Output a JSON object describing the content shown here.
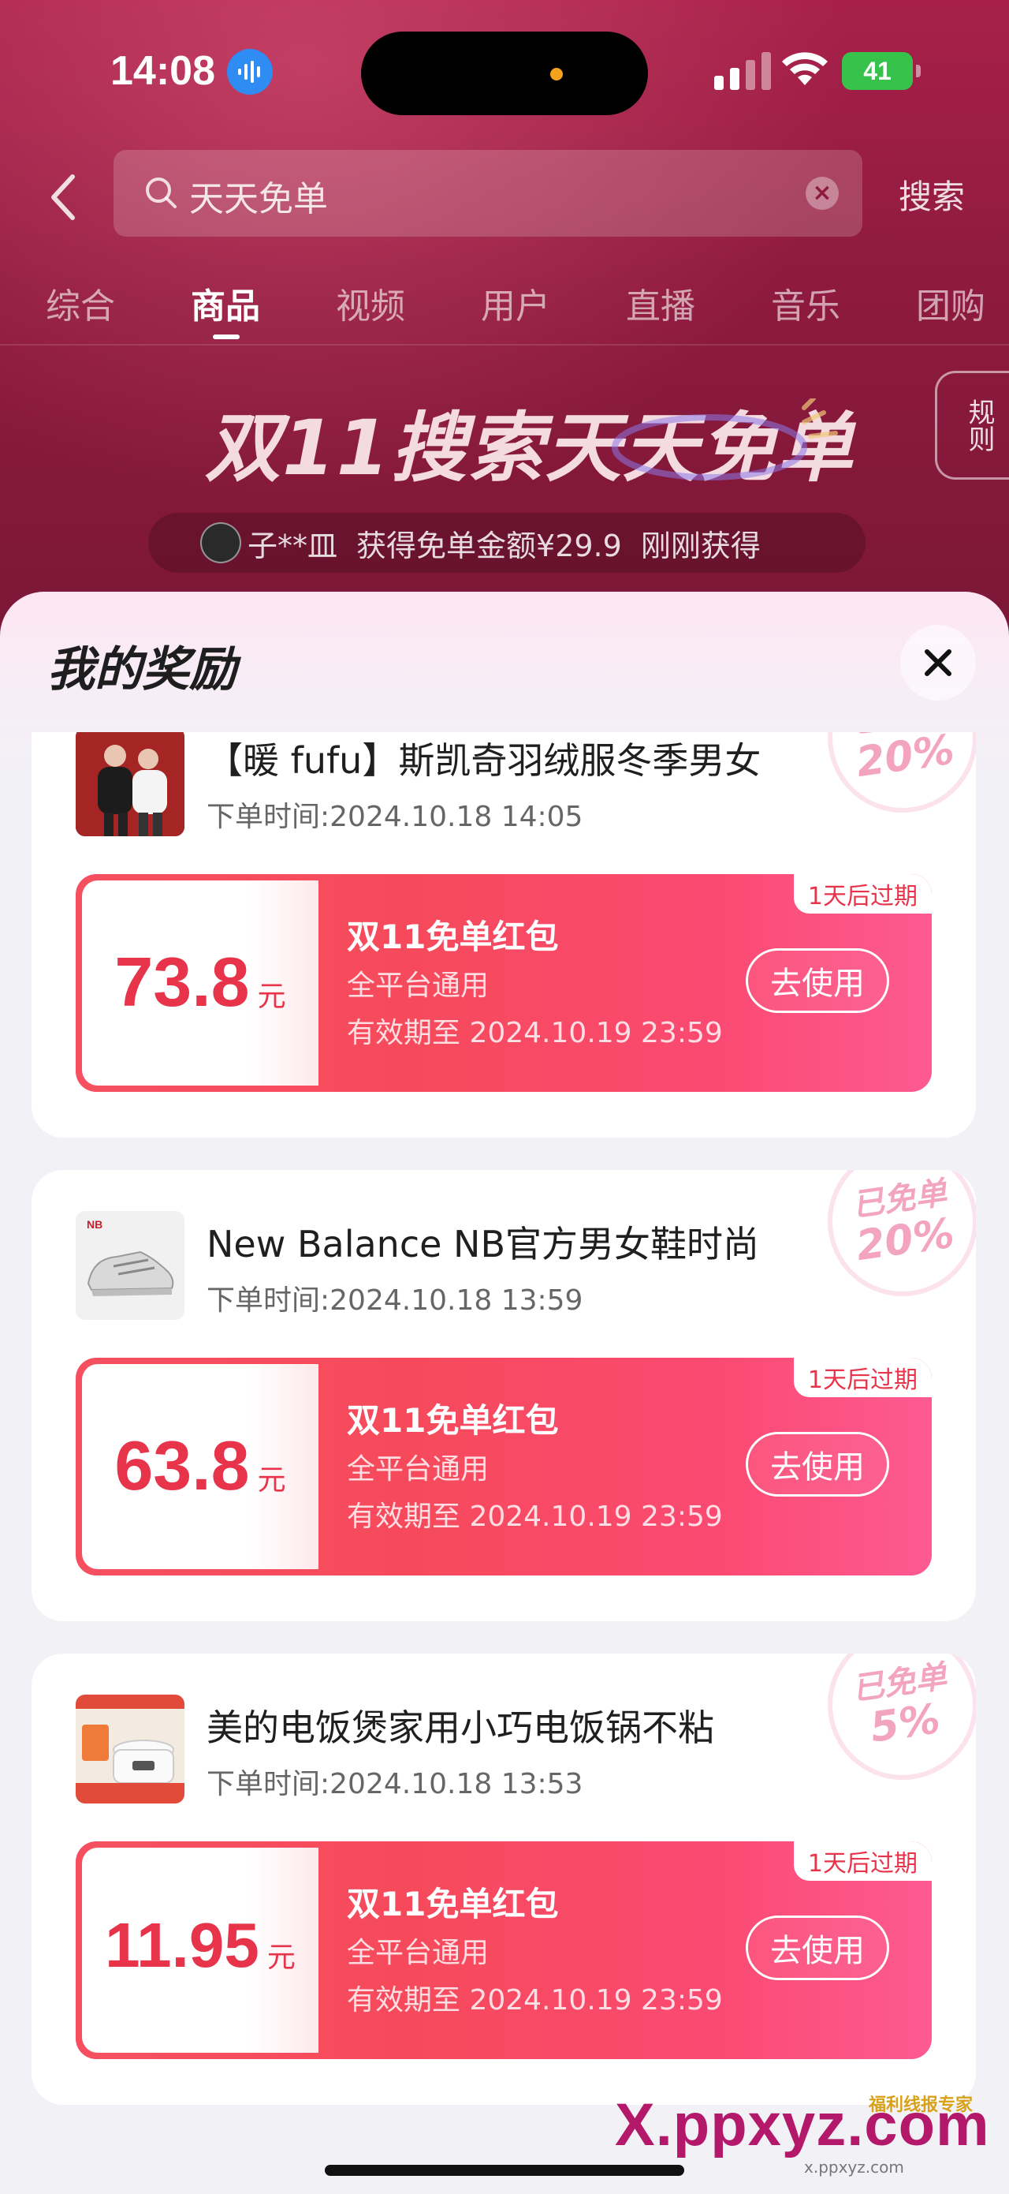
{
  "status_bar": {
    "time": "14:08",
    "battery": "41"
  },
  "search": {
    "query": "天天免单",
    "submit_label": "搜索"
  },
  "tabs": [
    {
      "label": "综合"
    },
    {
      "label": "商品"
    },
    {
      "label": "视频"
    },
    {
      "label": "用户"
    },
    {
      "label": "直播"
    },
    {
      "label": "音乐"
    },
    {
      "label": "团购"
    }
  ],
  "active_tab": "商品",
  "promo": {
    "banner": "双11搜索天天免单",
    "rules_label": "规则",
    "ticker_user": "子**皿",
    "ticker_text": "获得免单金额¥29.9",
    "ticker_time": "刚刚获得"
  },
  "sheet": {
    "title": "我的奖励"
  },
  "rewards": [
    {
      "title": "【暖 fufu】斯凯奇羽绒服冬季男女",
      "order_time": "下单时间:2024.10.18 14:05",
      "stamp_top": "已免单",
      "stamp_pct": "20%",
      "amount": "73.8",
      "unit": "元",
      "coupon_name": "双11免单红包",
      "scope": "全平台通用",
      "valid_until": "有效期至 2024.10.19 23:59",
      "expire_tag": "1天后过期",
      "use_label": "去使用"
    },
    {
      "title": "New Balance NB官方男女鞋时尚",
      "order_time": "下单时间:2024.10.18 13:59",
      "stamp_top": "已免单",
      "stamp_pct": "20%",
      "amount": "63.8",
      "unit": "元",
      "coupon_name": "双11免单红包",
      "scope": "全平台通用",
      "valid_until": "有效期至 2024.10.19 23:59",
      "expire_tag": "1天后过期",
      "use_label": "去使用"
    },
    {
      "title": "美的电饭煲家用小巧电饭锅不粘",
      "order_time": "下单时间:2024.10.18 13:53",
      "stamp_top": "已免单",
      "stamp_pct": "5%",
      "amount": "11.95",
      "unit": "元",
      "coupon_name": "双11免单红包",
      "scope": "全平台通用",
      "valid_until": "有效期至 2024.10.19 23:59",
      "expire_tag": "1天后过期",
      "use_label": "去使用"
    }
  ],
  "watermark": {
    "main": "X.ppxyz.com",
    "sub": "x.ppxyz.com",
    "badge": "福利线报专家"
  },
  "colors": {
    "accent": "#e8344a",
    "sheet_bg": "#f2f2f6",
    "top_bg": "#8e1a3f"
  }
}
